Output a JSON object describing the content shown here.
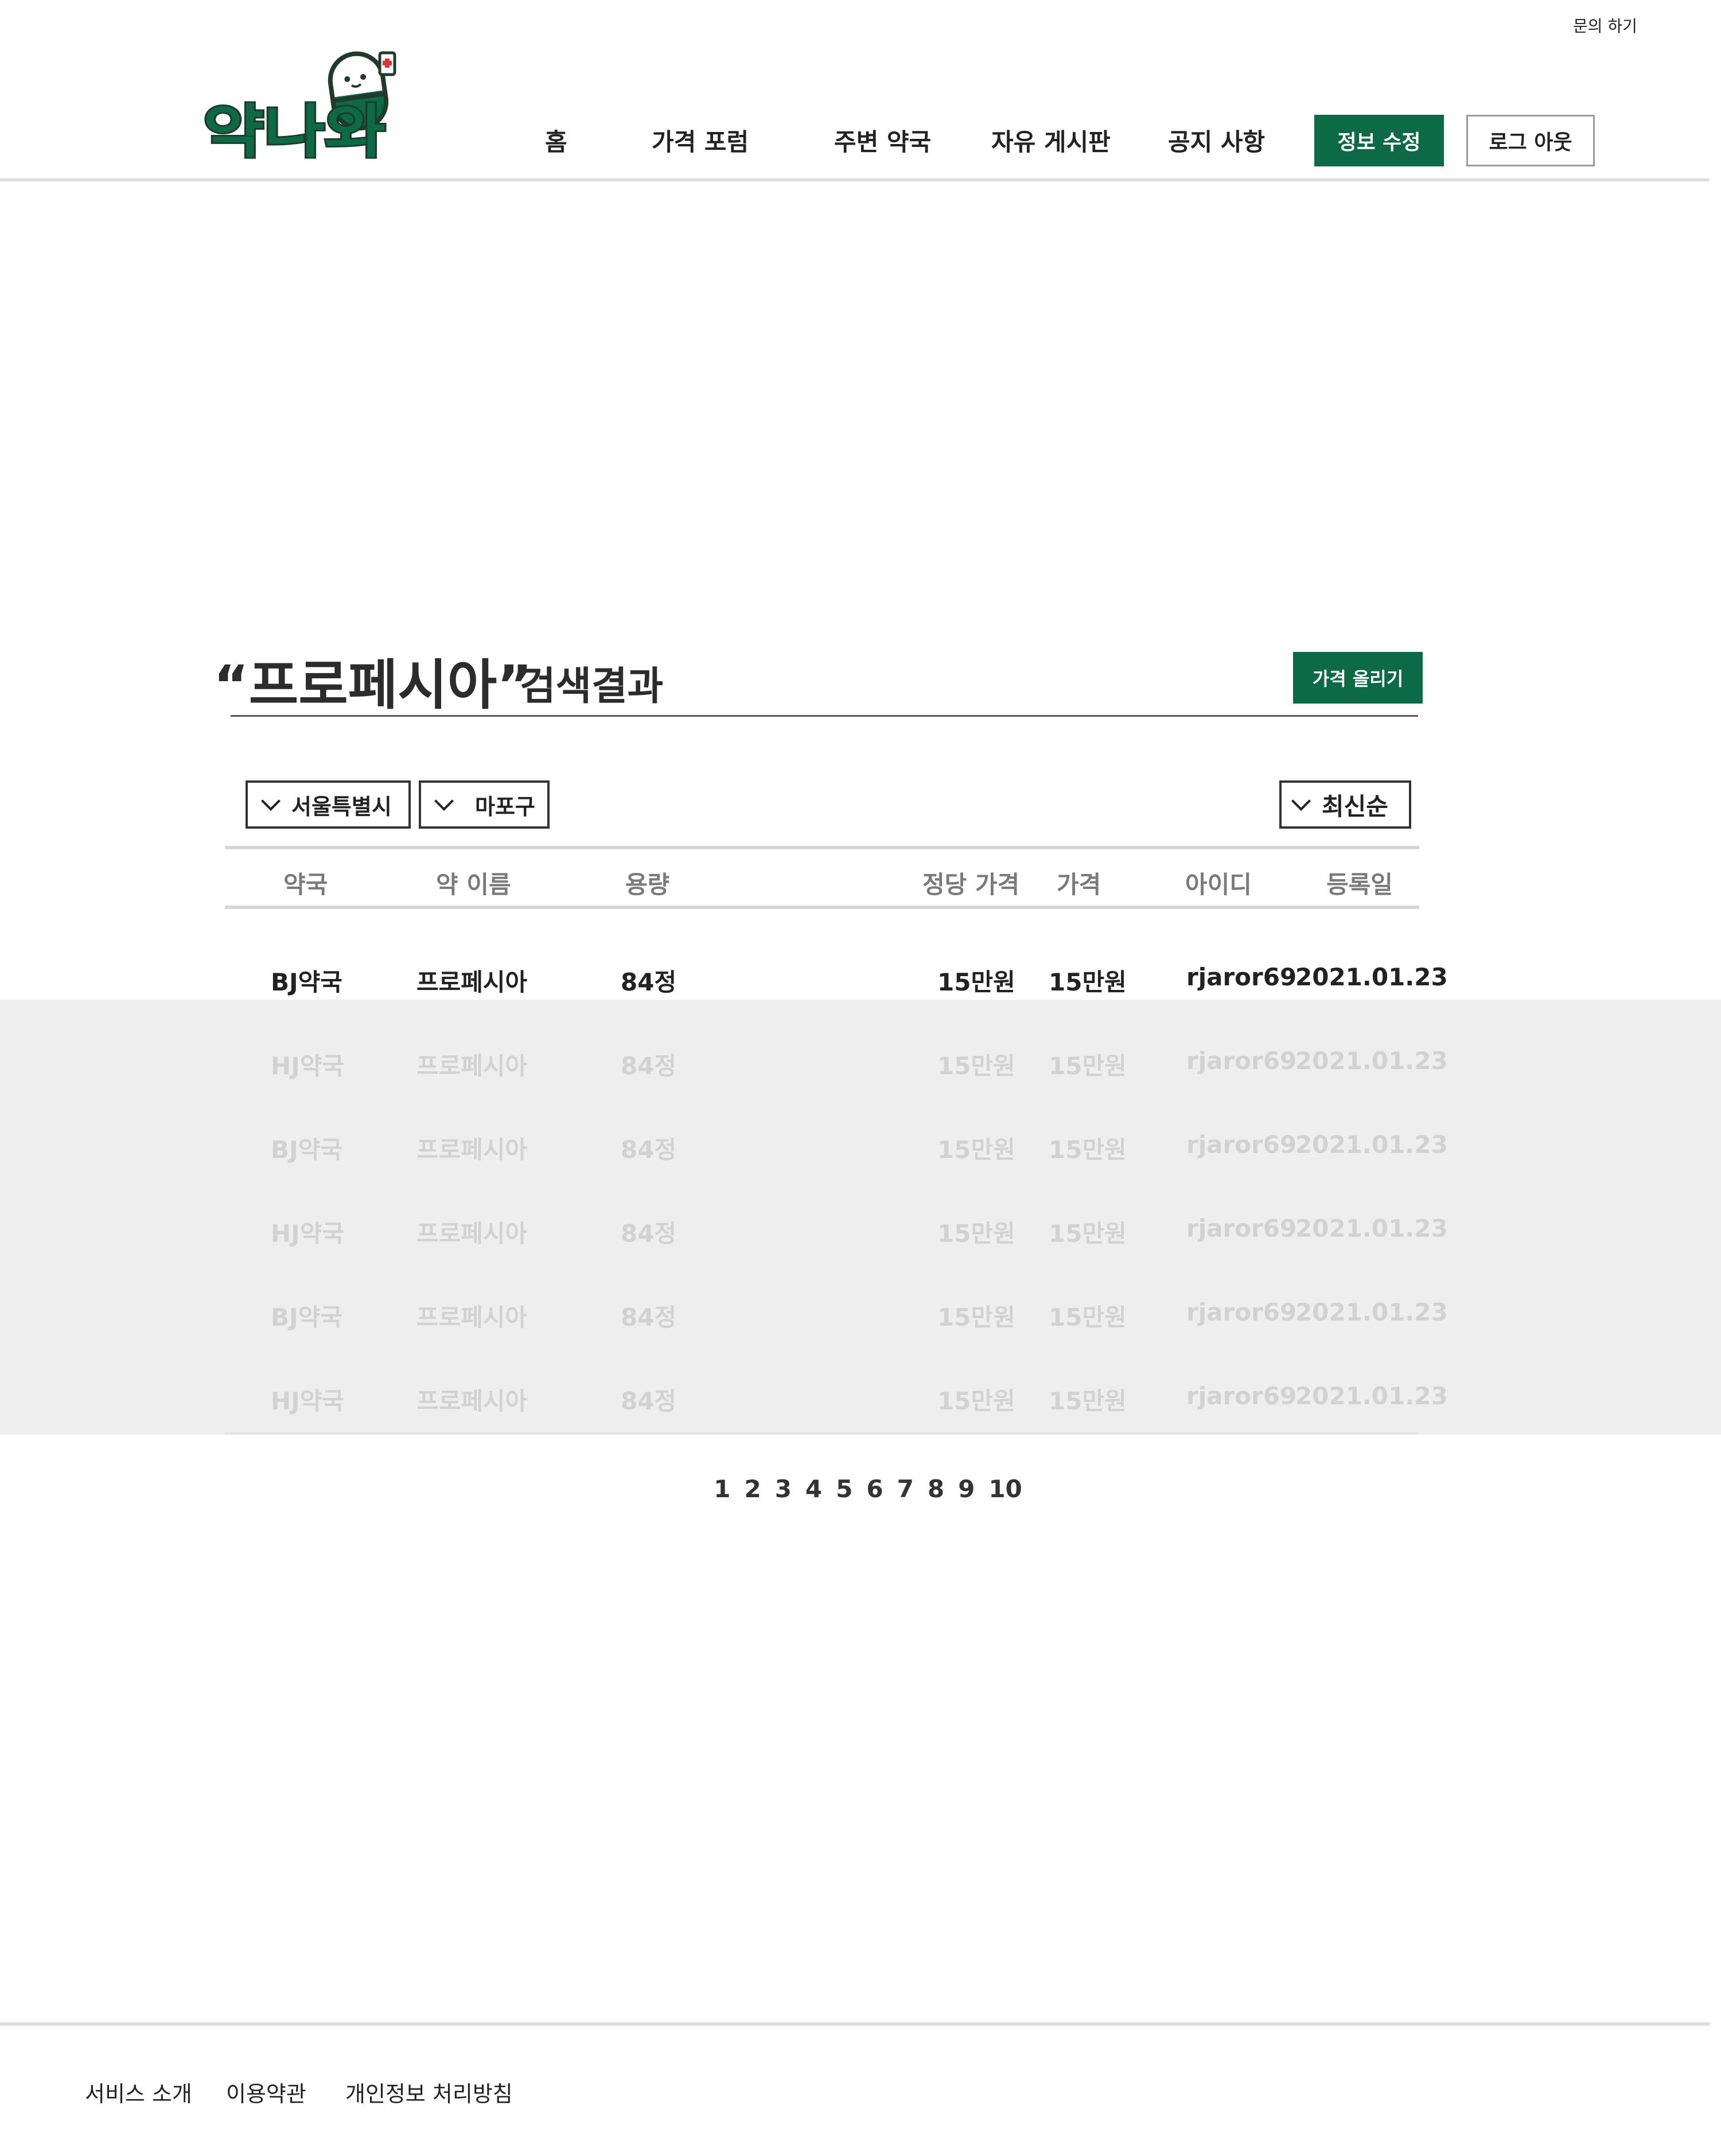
{
  "header": {
    "inquiry": "문의 하기",
    "logo_text": "약나와",
    "nav": [
      "홈",
      "가격 포럼",
      "주변 약국",
      "자유 게시판",
      "공지 사항"
    ],
    "edit_info": "정보 수정",
    "logout": "로그 아웃"
  },
  "search": {
    "query_display": "“프로페시아”",
    "suffix": "검색결과",
    "post_price": "가격 올리기"
  },
  "filters": {
    "city": "서울특별시",
    "district": "마포구",
    "sort": "최신순"
  },
  "table": {
    "headers": [
      "약국",
      "약 이름",
      "용량",
      "정당 가격",
      "가격",
      "아이디",
      "등록일"
    ],
    "rows": [
      [
        "BJ약국",
        "프로페시아",
        "84정",
        "15만원",
        "15만원",
        "rjaror69",
        "2021.01.23"
      ],
      [
        "HJ약국",
        "프로페시아",
        "84정",
        "15만원",
        "15만원",
        "rjaror69",
        "2021.01.23"
      ],
      [
        "BJ약국",
        "프로페시아",
        "84정",
        "15만원",
        "15만원",
        "rjaror69",
        "2021.01.23"
      ],
      [
        "HJ약국",
        "프로페시아",
        "84정",
        "15만원",
        "15만원",
        "rjaror69",
        "2021.01.23"
      ],
      [
        "BJ약국",
        "프로페시아",
        "84정",
        "15만원",
        "15만원",
        "rjaror69",
        "2021.01.23"
      ],
      [
        "HJ약국",
        "프로페시아",
        "84정",
        "15만원",
        "15만원",
        "rjaror69",
        "2021.01.23"
      ]
    ]
  },
  "pagination": [
    "1",
    "2",
    "3",
    "4",
    "5",
    "6",
    "7",
    "8",
    "9",
    "10"
  ],
  "footer": {
    "links": [
      "서비스 소개",
      "이용약관",
      "개인정보 처리방침"
    ]
  },
  "colors": {
    "brand_green": "#0c6b46",
    "text": "#222222",
    "faded_text": "#d2d2d2",
    "faded_band": "#eeeeee"
  }
}
